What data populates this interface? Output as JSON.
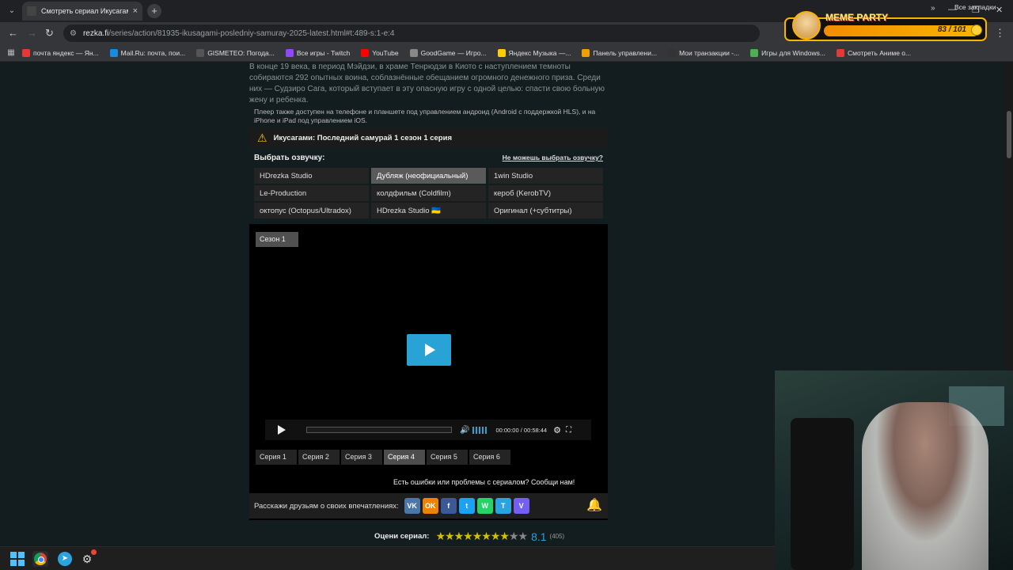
{
  "browser": {
    "tab": {
      "title": "Смотреть сериал Икусагами: Г",
      "close": "×"
    },
    "new_tab": "+",
    "url_host": "rezka.fi",
    "url_path": "/series/action/81935-ikusagami-posledniy-samuray-2025-latest.html#t:489-s:1-e:4",
    "bookmarks": [
      {
        "label": "почта яндекс — Ян...",
        "color": "#e53935"
      },
      {
        "label": "Mail.Ru: почта, пои...",
        "color": "#168de2"
      },
      {
        "label": "GISMETEO: Погода...",
        "color": "#555555"
      },
      {
        "label": "Все игры - Twitch",
        "color": "#9146ff"
      },
      {
        "label": "YouTube",
        "color": "#ff0000"
      },
      {
        "label": "GoodGame — Игро...",
        "color": "#888888"
      },
      {
        "label": "Яндекс Музыка —...",
        "color": "#ffcc00"
      },
      {
        "label": "Панель управлени...",
        "color": "#f0a000"
      },
      {
        "label": "Мои транзакции -...",
        "color": "#333333"
      },
      {
        "label": "Игры для Windows...",
        "color": "#4caf50"
      },
      {
        "label": "Смотреть Аниме о...",
        "color": "#e53935"
      }
    ],
    "bookmarks_all": "Все закладки"
  },
  "page": {
    "description": "В конце 19 века, в период Мэйдзи, в храме Тенрюдзи в Киото с наступлением темноты собираются 292 опытных воина, соблазнённые обещанием огромного денежного приза. Среди них — Судзиро Сага, который вступает в эту опасную игру с одной целью: спасти свою больную жену и ребенка.",
    "player_note": "Плеер также доступен на телефоне и планшете под управлением андроид (Android с поддержкой HLS), и на iPhone и iPad под управлением iOS.",
    "warning_title": "Икусагами: Последний самурай 1 сезон 1 серия",
    "voice_title": "Выбрать озвучку:",
    "voice_help": "Не можешь выбрать озвучку?",
    "voices": [
      {
        "label": "HDrezka Studio",
        "active": false
      },
      {
        "label": "Дубляж (неофициальный)",
        "active": true
      },
      {
        "label": "1win Studio",
        "active": false
      },
      {
        "label": "Le-Production",
        "active": false
      },
      {
        "label": "колдфильм (Coldfilm)",
        "active": false
      },
      {
        "label": "кероб (KerobTV)",
        "active": false
      },
      {
        "label": "октопус (Octopus/Ultradox)",
        "active": false
      },
      {
        "label": "HDrezka Studio 🇺🇦",
        "active": false
      },
      {
        "label": "Оригинал (+субтитры)",
        "active": false
      }
    ],
    "season": "Сезон 1",
    "time": "00:00:00 / 00:58:44",
    "progress": 0,
    "volume": 1.0,
    "episodes": [
      {
        "label": "Серия 1",
        "active": false
      },
      {
        "label": "Серия 2",
        "active": false
      },
      {
        "label": "Серия 3",
        "active": false
      },
      {
        "label": "Серия 4",
        "active": true
      },
      {
        "label": "Серия 5",
        "active": false
      },
      {
        "label": "Серия 6",
        "active": false
      }
    ],
    "report": "Есть ошибки или проблемы с сериалом? Сообщи нам!",
    "share_label": "Расскажи друзьям о своих впечатлениях:",
    "share_buttons": [
      {
        "label": "VK",
        "color": "#4a76a8"
      },
      {
        "label": "OK",
        "color": "#ee8208"
      },
      {
        "label": "f",
        "color": "#3b5998"
      },
      {
        "label": "t",
        "color": "#1da1f2"
      },
      {
        "label": "W",
        "color": "#25d366"
      },
      {
        "label": "T",
        "color": "#2aa3de"
      },
      {
        "label": "V",
        "color": "#7360f2"
      }
    ],
    "rating_label": "Оцени сериал:",
    "rating_stars_filled": 8,
    "rating_stars_total": 10,
    "rating_value": "8.1",
    "rating_count": "(405)"
  },
  "overlay": {
    "meme_title": "MEME PARTY",
    "meme_count": "83 / 101",
    "meme_progress": 0.82
  },
  "accent": "#29a3d6"
}
